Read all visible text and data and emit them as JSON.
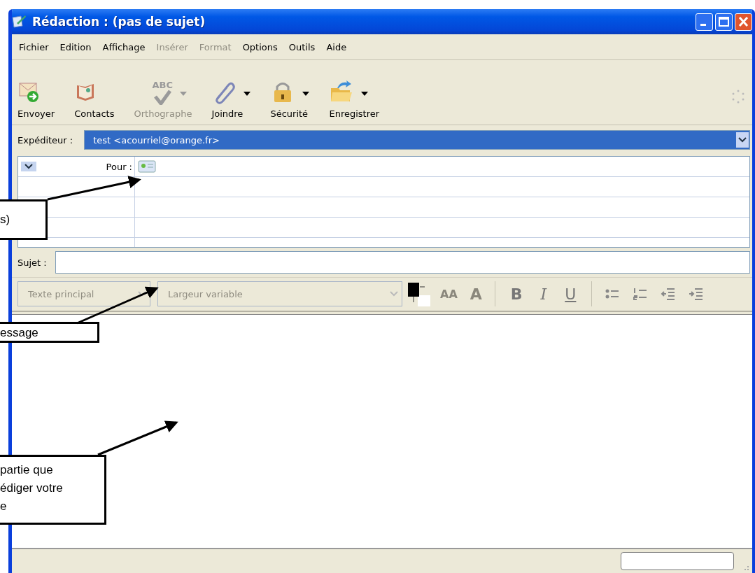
{
  "window": {
    "title": "Rédaction : (pas de sujet)"
  },
  "menu": [
    {
      "label": "Fichier",
      "disabled": false
    },
    {
      "label": "Edition",
      "disabled": false
    },
    {
      "label": "Affichage",
      "disabled": false
    },
    {
      "label": "Insérer",
      "disabled": true
    },
    {
      "label": "Format",
      "disabled": true
    },
    {
      "label": "Options",
      "disabled": false
    },
    {
      "label": "Outils",
      "disabled": false
    },
    {
      "label": "Aide",
      "disabled": false
    }
  ],
  "toolbar": [
    {
      "label": "Envoyer",
      "disabled": false,
      "dropdown": false
    },
    {
      "label": "Contacts",
      "disabled": false,
      "dropdown": false
    },
    {
      "label": "Orthographe",
      "disabled": true,
      "dropdown": true,
      "icon_text": "ABC"
    },
    {
      "label": "Joindre",
      "disabled": false,
      "dropdown": true
    },
    {
      "label": "Sécurité",
      "disabled": false,
      "dropdown": true
    },
    {
      "label": "Enregistrer",
      "disabled": false,
      "dropdown": true
    }
  ],
  "sender": {
    "label": "Expéditeur :",
    "value": "test <acourriel@orange.fr>",
    "selected": true
  },
  "recipients": [
    {
      "type": "Pour :"
    }
  ],
  "subject": {
    "label": "Sujet :"
  },
  "format_bar": {
    "style": {
      "value": "Texte principal",
      "disabled": true
    },
    "font": {
      "value": "Largeur variable",
      "disabled": true
    },
    "size_buttons": [
      {
        "label": "AA",
        "disabled": true
      },
      {
        "label": "A",
        "disabled": true
      }
    ],
    "style_buttons": [
      {
        "label": "B",
        "kind": "bold"
      },
      {
        "label": "I",
        "kind": "italic"
      },
      {
        "label": "U",
        "kind": "underline"
      }
    ]
  },
  "callouts": [
    {
      "lines": [
        "s)"
      ]
    },
    {
      "lines": [
        "essage"
      ]
    },
    {
      "lines": [
        "partie que",
        "édiger votre",
        "e"
      ]
    }
  ]
}
